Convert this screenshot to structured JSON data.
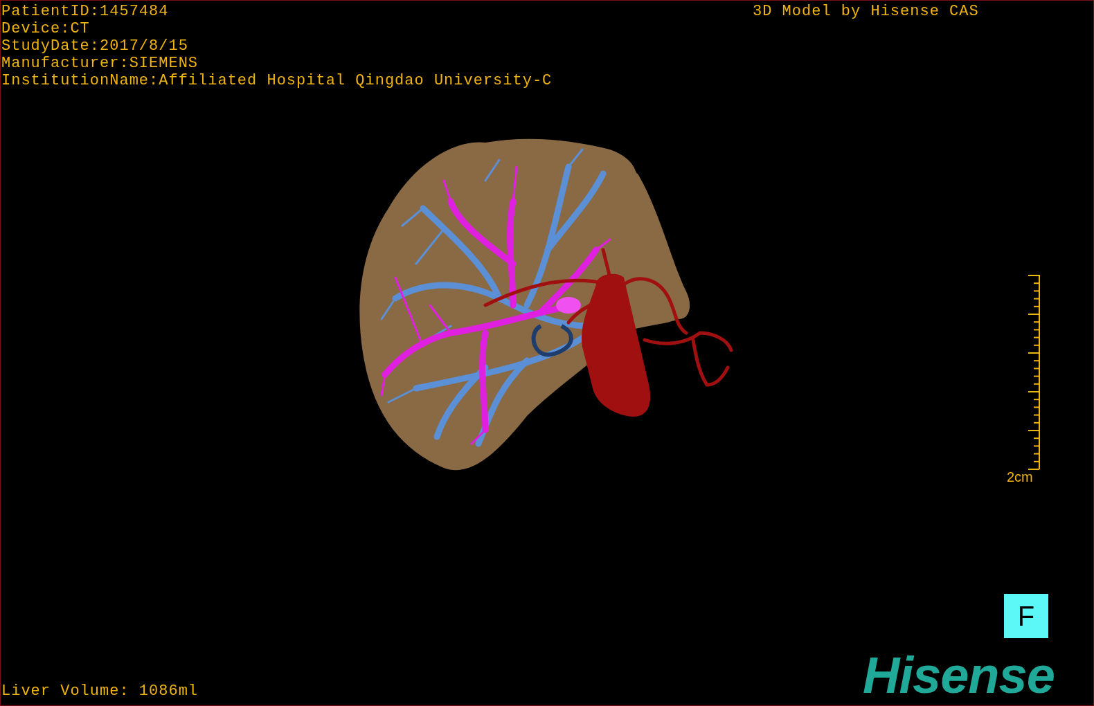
{
  "patient_info": [
    "PatientID:1457484",
    "Device:CT",
    "StudyDate:2017/8/15",
    "Manufacturer:SIEMENS",
    "InstitutionName:Affiliated Hospital Qingdao University-C"
  ],
  "header_title": "3D Model by Hisense CAS",
  "scale_bar": {
    "label": "2cm"
  },
  "orientation_marker": "F",
  "logo": "Hisense",
  "liver_volume": "Liver Volume: 1086ml"
}
